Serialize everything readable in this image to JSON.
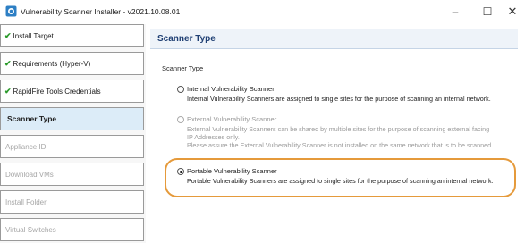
{
  "window": {
    "title": "Vulnerability Scanner Installer - v2021.10.08.01",
    "minimize_glyph": "–",
    "maximize_glyph": "☐",
    "close_glyph": "✕"
  },
  "sidebar": {
    "items": [
      {
        "label": "Install Target",
        "state": "done"
      },
      {
        "label": "Requirements (Hyper-V)",
        "state": "done"
      },
      {
        "label": "RapidFire Tools Credentials",
        "state": "done"
      },
      {
        "label": "Scanner Type",
        "state": "active"
      },
      {
        "label": "Appliance ID",
        "state": "pending"
      },
      {
        "label": "Download VMs",
        "state": "pending"
      },
      {
        "label": "Install Folder",
        "state": "pending"
      },
      {
        "label": "Virtual Switches",
        "state": "pending"
      }
    ],
    "check_glyph": "✔"
  },
  "main": {
    "header_title": "Scanner Type",
    "group_label": "Scanner Type",
    "options": [
      {
        "label": "Internal Vulnerability Scanner",
        "selected": false,
        "enabled": true,
        "description": [
          "Internal Vulnerability Scanners are assigned to single sites for the purpose of scanning an internal network."
        ]
      },
      {
        "label": "External Vulnerability Scanner",
        "selected": false,
        "enabled": false,
        "description": [
          "External Vulnerability Scanners can be shared by multiple sites for the purpose of scanning external facing",
          "IP Addresses only.",
          "Please assure the External Vulnerability Scanner is not installed on the same network that is to be scanned."
        ]
      },
      {
        "label": "Portable Vulnerability Scanner",
        "selected": true,
        "enabled": true,
        "description": [
          "Portable Vulnerability Scanners are assigned to single sites for the purpose of scanning an internal network."
        ]
      }
    ]
  },
  "colors": {
    "highlight": "#e59a3b",
    "active_item_bg": "#dcecf8",
    "header_text": "#1f3f73",
    "check": "#2a9a2a"
  }
}
